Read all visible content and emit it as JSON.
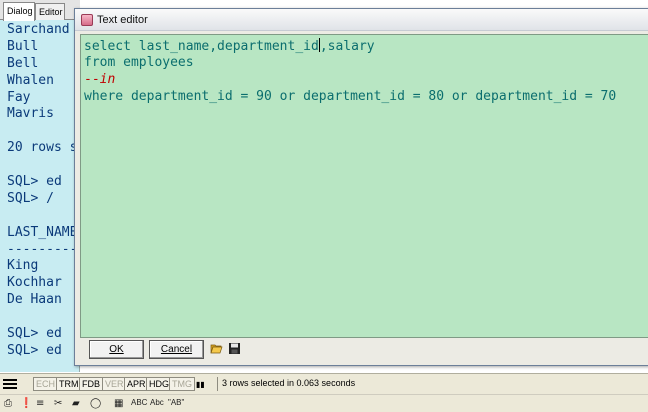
{
  "left_panel": {
    "tabs": [
      "Dialog",
      "Editor"
    ],
    "console_lines": [
      "Sarchand",
      "Bull",
      "Bell",
      "Whalen",
      "Fay",
      "Mavris",
      "",
      "20 rows s",
      "",
      "SQL> ed",
      "SQL> /",
      "",
      "LAST_NAME",
      "---------",
      "King",
      "Kochhar",
      "De Haan",
      "",
      "SQL> ed",
      "SQL> ed"
    ]
  },
  "editor": {
    "title": "Text editor",
    "code": {
      "line1_before_caret": "select last_name,department_id",
      "line1_after_caret": ",salary",
      "line2": "from employees",
      "line3_dashes": "--",
      "line3_keyword": "in",
      "line4": "where department_id = 90 or department_id = 80 or department_id = 70"
    },
    "ok_label": "OK",
    "cancel_label": "Cancel",
    "background_color": "#b8e6c3",
    "text_color": "#0b6e6e",
    "comment_color": "#c00000"
  },
  "status_bar": {
    "modes": [
      {
        "label": "ECH",
        "active": false
      },
      {
        "label": "TRM",
        "active": true
      },
      {
        "label": "FDB",
        "active": true
      },
      {
        "label": "VER",
        "active": false
      },
      {
        "label": "APR",
        "active": true
      },
      {
        "label": "HDG",
        "active": true
      },
      {
        "label": "TMG",
        "active": false
      }
    ],
    "message": "3 rows selected in 0.063 seconds"
  },
  "bottom_toolbar": {
    "icons": [
      "print-icon",
      "binoculars-icon",
      "format-icon",
      "scissors-icon",
      "eraser-icon",
      "output-icon",
      "grid-icon",
      "abc-icon",
      "abc-case-icon",
      "quote-ab-icon"
    ],
    "abc_label": "ABC",
    "abc_case_label": "Abc",
    "quote_label": "\"AB\""
  }
}
